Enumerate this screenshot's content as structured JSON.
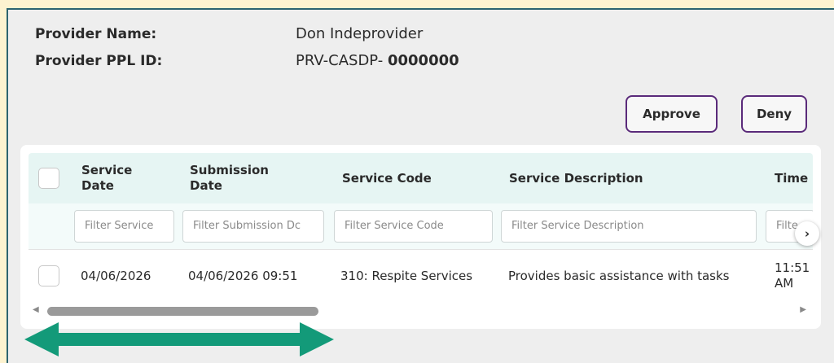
{
  "provider": {
    "name_label": "Provider Name:",
    "name_value": "Don Indeprovider",
    "id_label": "Provider PPL ID:",
    "id_prefix": "PRV-CASDP- ",
    "id_number": "0000000"
  },
  "actions": {
    "approve_label": "Approve",
    "deny_label": "Deny"
  },
  "table": {
    "columns": [
      {
        "line1": "Service",
        "line2": "Date"
      },
      {
        "line1": "Submission",
        "line2": "Date"
      },
      {
        "line1": "Service Code",
        "line2": ""
      },
      {
        "line1": "Service Description",
        "line2": ""
      },
      {
        "line1": "Time",
        "line2": ""
      }
    ],
    "filters": [
      "Filter Service",
      "Filter Submission Dc",
      "Filter Service Code",
      "Filter Service Description",
      "Filte"
    ],
    "rows": [
      {
        "service_date": "04/06/2026",
        "submission_date": "04/06/2026 09:51",
        "service_code": "310: Respite Services",
        "service_description": "Provides basic assistance with tasks",
        "time_line1": "11:51",
        "time_line2": "AM"
      }
    ]
  },
  "icons": {
    "scroll_next": "chevron-right-icon",
    "scroll_left": "triangle-left-icon",
    "scroll_right": "triangle-right-icon",
    "annotation": "double-arrow-icon"
  },
  "colors": {
    "accent_purple": "#5a2a7a",
    "header_teal": "#e6f5f3",
    "annotation_green": "#139a79",
    "page_bg": "#eeeeee"
  }
}
